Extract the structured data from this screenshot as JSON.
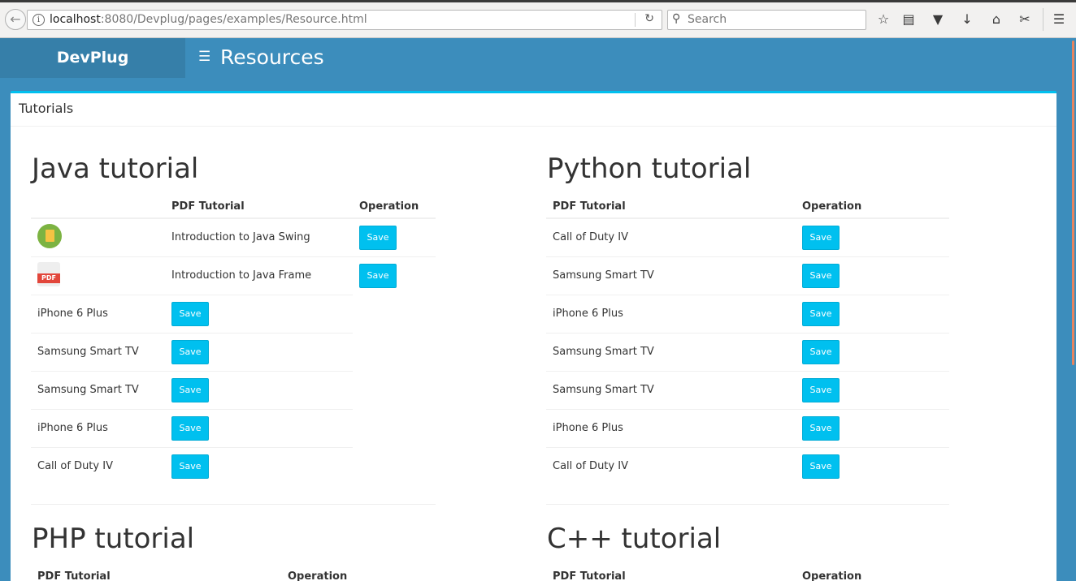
{
  "browser": {
    "url_host": "localhost",
    "url_rest": ":8080/Devplug/pages/examples/Resource.html",
    "search_placeholder": "Search"
  },
  "header": {
    "logo": "DevPlug",
    "title": "Resources"
  },
  "box": {
    "title": "Tutorials"
  },
  "labels": {
    "save": "Save",
    "pdf": "PDF"
  },
  "sections": {
    "java": {
      "title": "Java tutorial",
      "columns": [
        "",
        "PDF Tutorial",
        "Operation"
      ],
      "rows": [
        "Introduction to Java Swing",
        "Introduction to Java Frame",
        "iPhone 6 Plus",
        "Samsung Smart TV",
        "Samsung Smart TV",
        "iPhone 6 Plus",
        "Call of Duty IV"
      ]
    },
    "python": {
      "title": "Python tutorial",
      "columns": [
        "PDF Tutorial",
        "Operation"
      ],
      "rows": [
        "Call of Duty IV",
        "Samsung Smart TV",
        "iPhone 6 Plus",
        "Samsung Smart TV",
        "Samsung Smart TV",
        "iPhone 6 Plus",
        "Call of Duty IV"
      ]
    },
    "php": {
      "title": "PHP tutorial",
      "columns": [
        "PDF Tutorial",
        "Operation"
      ]
    },
    "cpp": {
      "title": "C++ tutorial",
      "columns": [
        "PDF Tutorial",
        "Operation"
      ]
    }
  },
  "colors": {
    "brand": "#3c8dbc",
    "logo_bg": "#367fa9",
    "accent": "#00c0ef"
  }
}
